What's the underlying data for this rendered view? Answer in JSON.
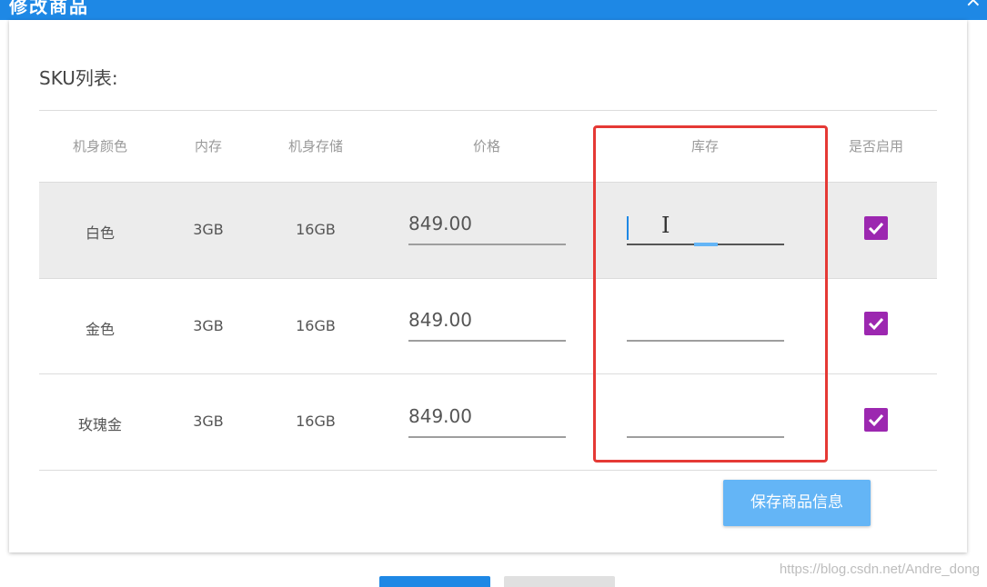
{
  "dialog": {
    "title": "修改商品",
    "close_glyph": "×"
  },
  "sku": {
    "label": "SKU列表:",
    "headers": [
      "机身颜色",
      "内存",
      "机身存储",
      "价格",
      "库存",
      "是否启用"
    ],
    "rows": [
      {
        "color": "白色",
        "memory": "3GB",
        "storage": "16GB",
        "price": "849.00",
        "stock": "",
        "enabled": true
      },
      {
        "color": "金色",
        "memory": "3GB",
        "storage": "16GB",
        "price": "849.00",
        "stock": "",
        "enabled": true
      },
      {
        "color": "玫瑰金",
        "memory": "3GB",
        "storage": "16GB",
        "price": "849.00",
        "stock": "",
        "enabled": true
      }
    ],
    "save_label": "保存商品信息"
  },
  "watermark": "https://blog.csdn.net/Andre_dong",
  "colors": {
    "primary": "#1e88e5",
    "checkbox": "#9c27b0",
    "highlight": "#e53935",
    "save_button": "#64b5f6"
  },
  "icons": {
    "text_cursor": "I"
  }
}
